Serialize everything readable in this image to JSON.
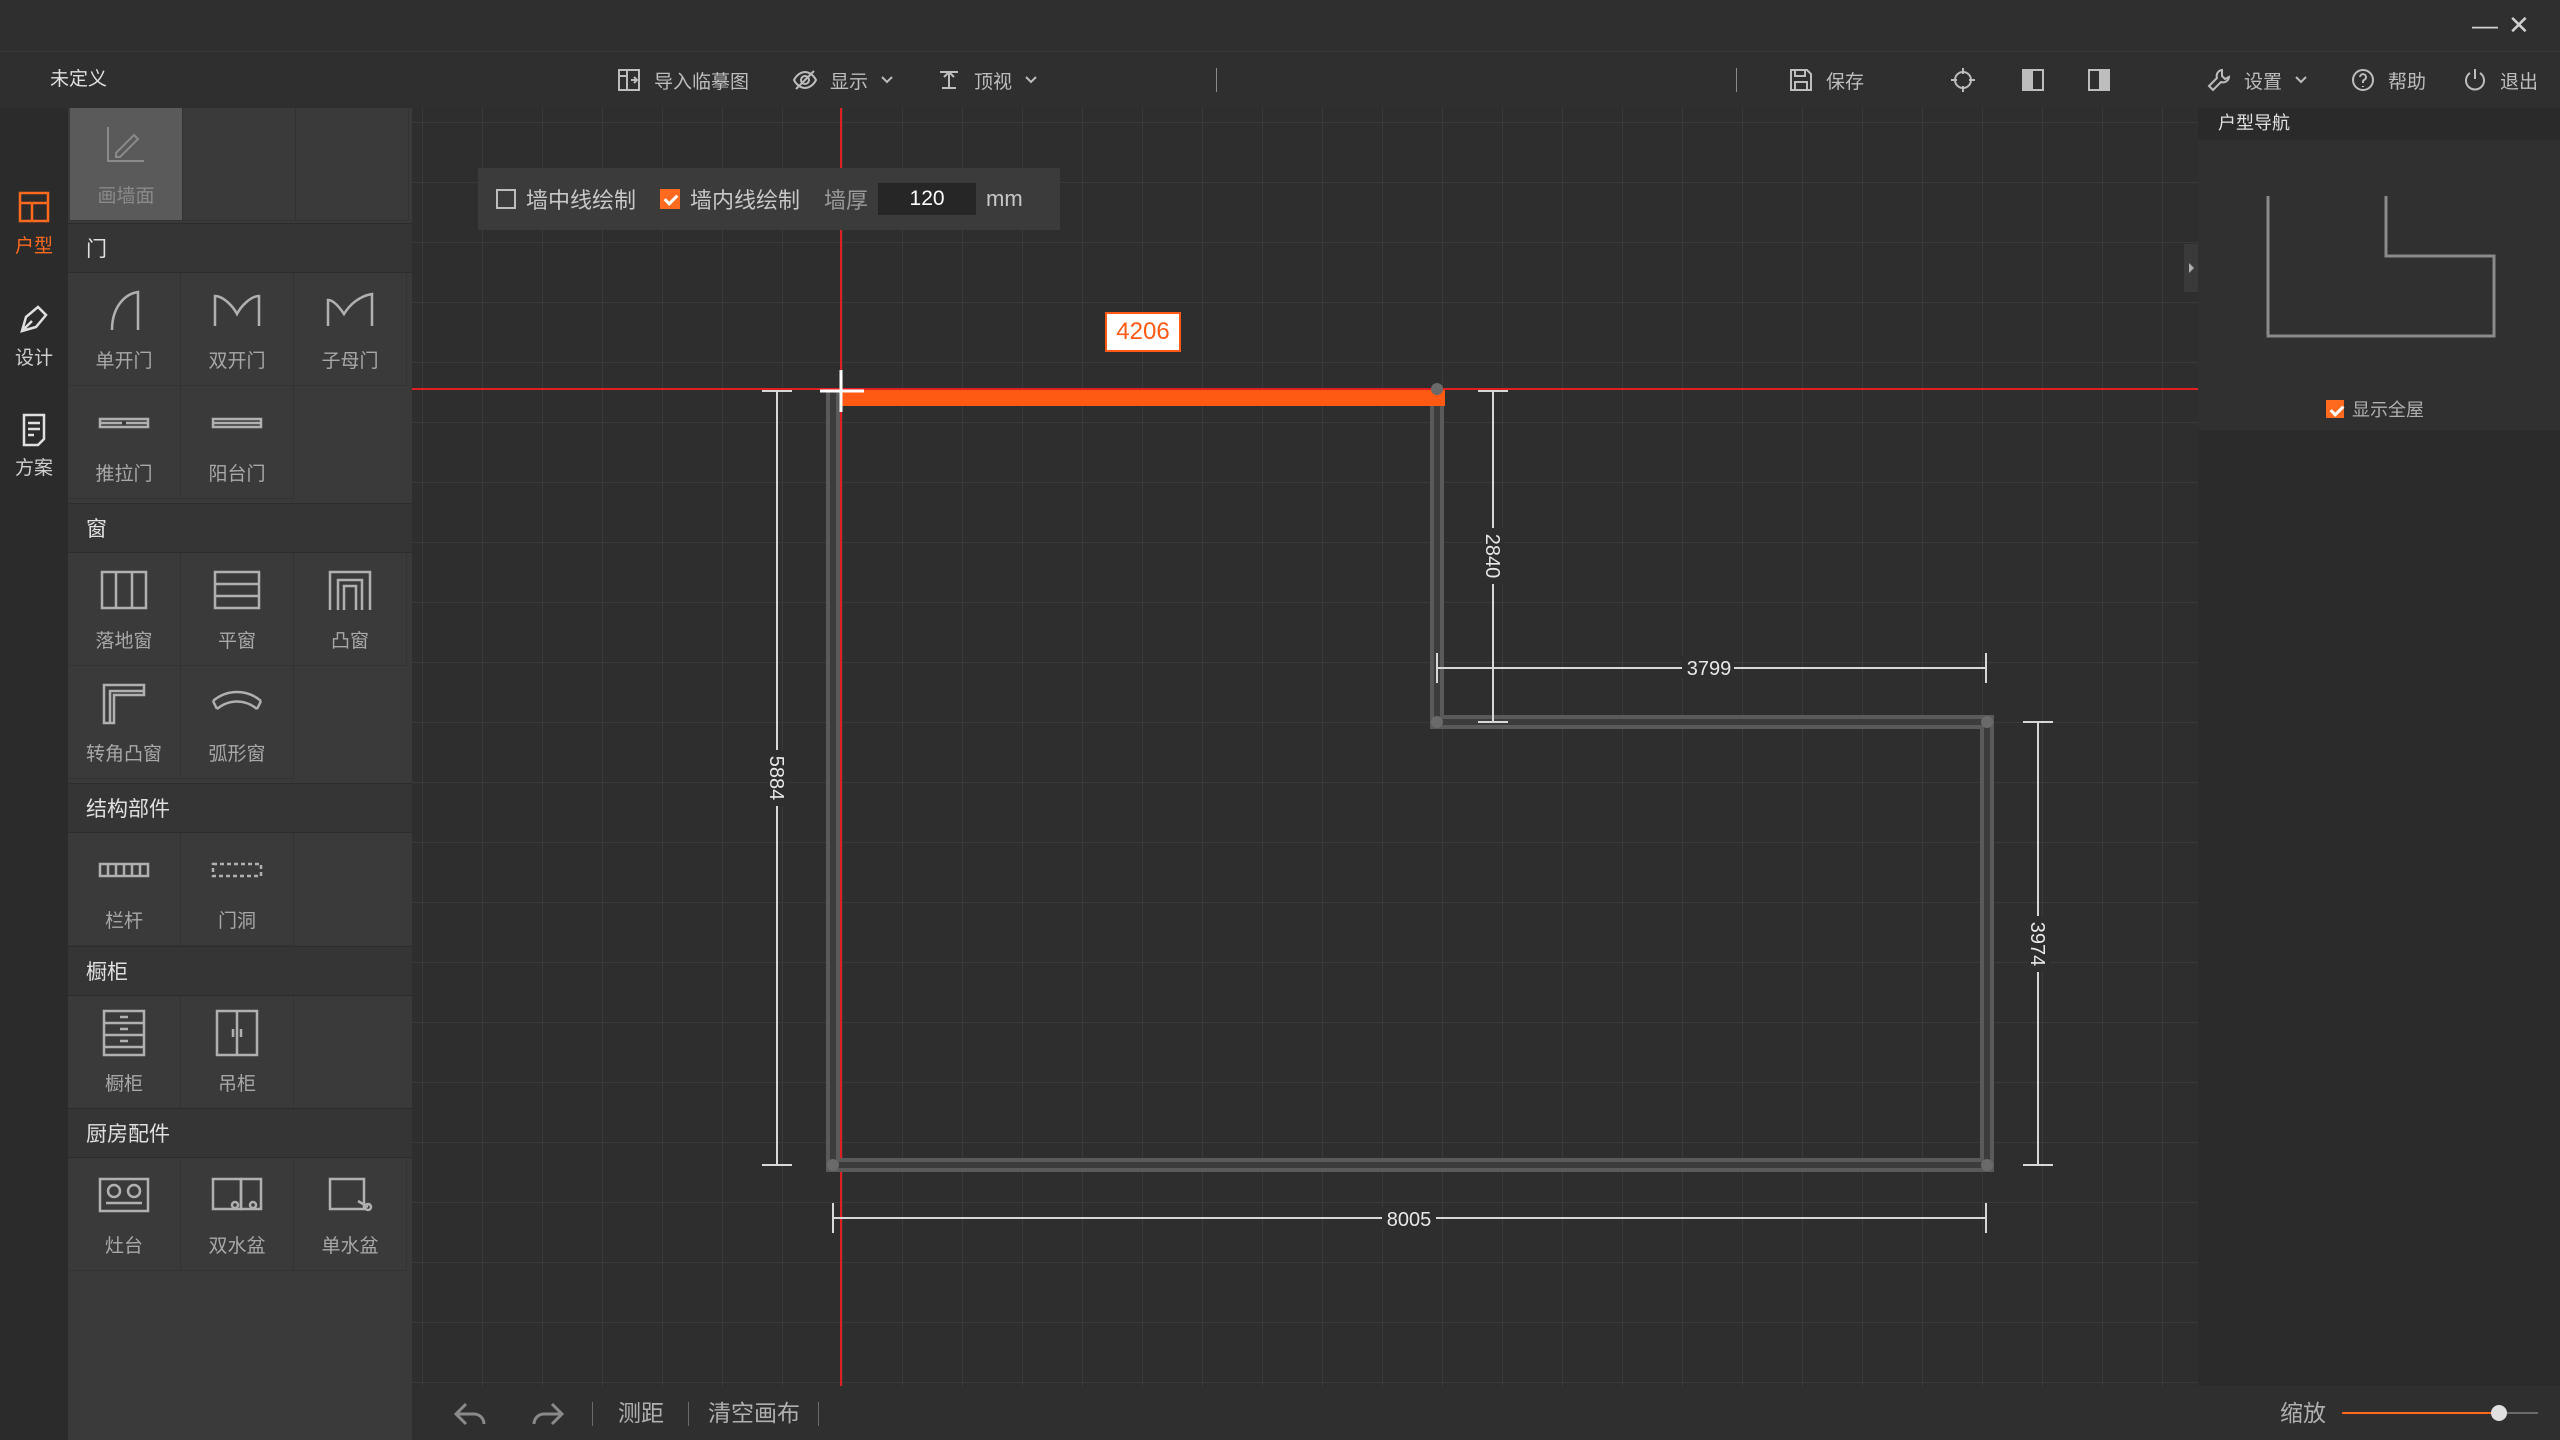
{
  "window": {
    "title": "未定义",
    "controls": {
      "minimize": "—",
      "close": "✕"
    }
  },
  "toolbar": {
    "import_label": "导入临摹图",
    "display_label": "显示",
    "view_label": "顶视",
    "save_label": "保存",
    "settings_label": "设置",
    "help_label": "帮助",
    "exit_label": "退出"
  },
  "left_nav": {
    "items": [
      {
        "label": "户型",
        "icon": "floorplan-icon",
        "active": true
      },
      {
        "label": "设计",
        "icon": "pen-icon",
        "active": false
      },
      {
        "label": "方案",
        "icon": "document-icon",
        "active": false
      }
    ]
  },
  "palette": {
    "draw_wall": {
      "label": "画墙面",
      "icon": "draw-wall-icon"
    },
    "categories": [
      {
        "title": "门",
        "items": [
          {
            "label": "单开门",
            "icon": "single-door-icon"
          },
          {
            "label": "双开门",
            "icon": "double-door-icon"
          },
          {
            "label": "子母门",
            "icon": "mother-son-door-icon"
          },
          {
            "label": "推拉门",
            "icon": "sliding-door-icon"
          },
          {
            "label": "阳台门",
            "icon": "balcony-door-icon"
          }
        ]
      },
      {
        "title": "窗",
        "items": [
          {
            "label": "落地窗",
            "icon": "floor-window-icon"
          },
          {
            "label": "平窗",
            "icon": "flat-window-icon"
          },
          {
            "label": "凸窗",
            "icon": "bay-window-icon"
          },
          {
            "label": "转角凸窗",
            "icon": "corner-bay-window-icon"
          },
          {
            "label": "弧形窗",
            "icon": "arc-window-icon"
          }
        ]
      },
      {
        "title": "结构部件",
        "items": [
          {
            "label": "栏杆",
            "icon": "railing-icon"
          },
          {
            "label": "门洞",
            "icon": "door-opening-icon"
          }
        ]
      },
      {
        "title": "橱柜",
        "items": [
          {
            "label": "橱柜",
            "icon": "cabinet-icon"
          },
          {
            "label": "吊柜",
            "icon": "wall-cabinet-icon"
          }
        ]
      },
      {
        "title": "厨房配件",
        "items": [
          {
            "label": "灶台",
            "icon": "stove-icon"
          },
          {
            "label": "双水盆",
            "icon": "double-sink-icon"
          },
          {
            "label": "单水盆",
            "icon": "single-sink-icon"
          }
        ]
      }
    ]
  },
  "draw_options": {
    "center_line_label": "墙中线绘制",
    "center_line_checked": false,
    "inner_line_label": "墙内线绘制",
    "inner_line_checked": true,
    "thickness_label": "墙厚",
    "thickness_value": "120",
    "unit": "mm"
  },
  "floorplan": {
    "active_length": "4206",
    "dimensions": {
      "right_top": "2840",
      "middle_horizontal": "3799",
      "left_vertical": "5884",
      "right_bottom": "3974",
      "bottom": "8005"
    }
  },
  "navigator": {
    "title": "户型导航",
    "show_all_label": "显示全屋",
    "show_all_checked": true
  },
  "statusbar": {
    "measure_label": "测距",
    "clear_label": "清空画布",
    "zoom_label": "缩放",
    "zoom_level": 0.8
  },
  "colors": {
    "accent": "#ff6a1f",
    "guide_line": "#e02020",
    "wall": "#4a4a4a"
  }
}
